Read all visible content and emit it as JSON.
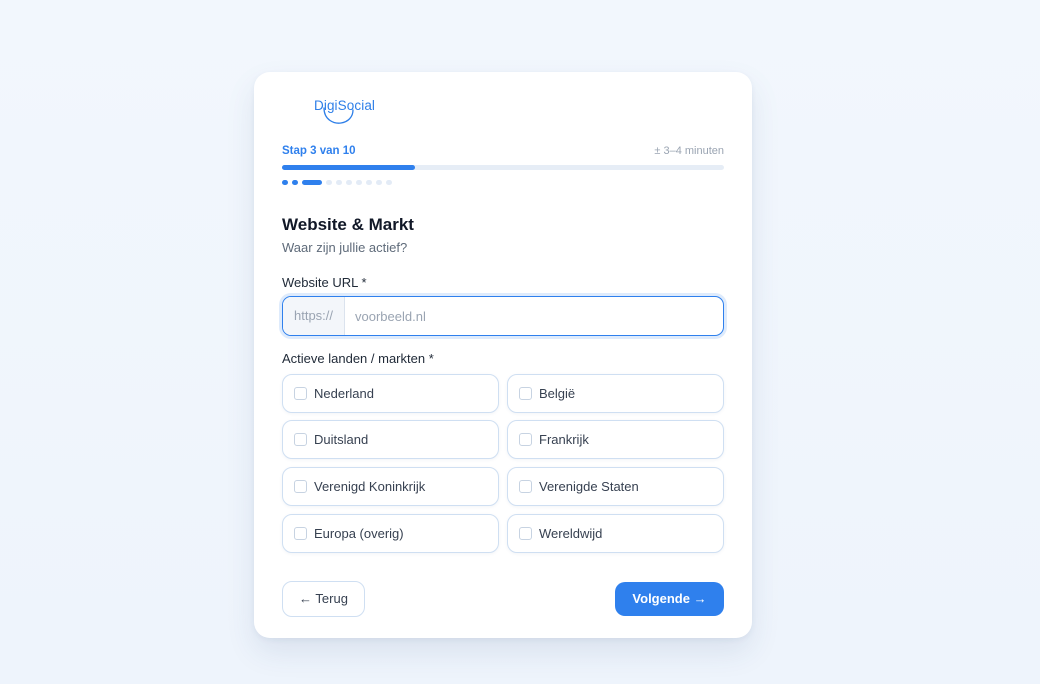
{
  "brand": {
    "logo_text": "DigiSocial",
    "accent_color": "#2f80ed"
  },
  "progress": {
    "step_label": "Stap 3 van 10",
    "time_estimate": "± 3–4 minuten",
    "current_step": 3,
    "total_steps": 10,
    "fraction": 0.3
  },
  "section": {
    "title": "Website & Markt",
    "subtitle": "Waar zijn jullie actief?"
  },
  "website": {
    "label": "Website URL *",
    "prefix": "https://",
    "placeholder": "voorbeeld.nl",
    "value": ""
  },
  "markets": {
    "label": "Actieve landen / markten *",
    "options": [
      {
        "label": "Nederland",
        "checked": false
      },
      {
        "label": "België",
        "checked": false
      },
      {
        "label": "Duitsland",
        "checked": false
      },
      {
        "label": "Frankrijk",
        "checked": false
      },
      {
        "label": "Verenigd Koninkrijk",
        "checked": false
      },
      {
        "label": "Verenigde Staten",
        "checked": false
      },
      {
        "label": "Europa (overig)",
        "checked": false
      },
      {
        "label": "Wereldwijd",
        "checked": false
      }
    ]
  },
  "nav": {
    "back_label": "← Terug",
    "next_label": "Volgende →"
  }
}
